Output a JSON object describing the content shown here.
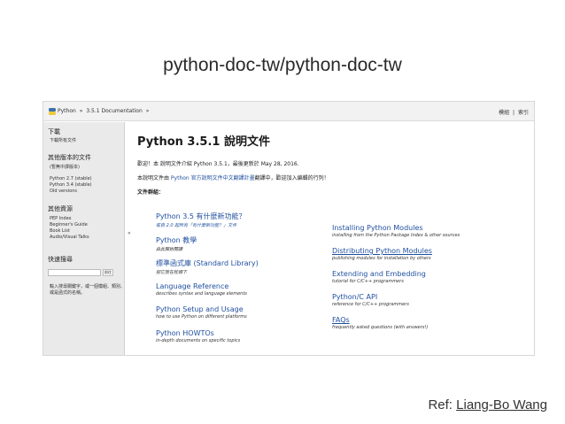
{
  "slide": {
    "title": "python-doc-tw/python-doc-tw",
    "ref_prefix": "Ref: ",
    "ref_author": "Liang-Bo Wang"
  },
  "topbar": {
    "crumbs": [
      "Python",
      "»",
      "3.5.1 Documentation",
      "»"
    ],
    "right": [
      "模組",
      "|",
      "索引"
    ]
  },
  "sidebar": {
    "download_heading": "下載",
    "download_link": "下載所有文件",
    "versions_heading": "其他版本的文件",
    "versions_note": "(暫無中譯版本)",
    "versions": [
      "Python 2.7 (stable)",
      "Python 3.4 (stable)",
      "Old versions"
    ],
    "resources_heading": "其他資源",
    "resources": [
      "PEP Index",
      "Beginner's Guide",
      "Book List",
      "Audio/Visual Talks"
    ],
    "search_heading": "快速搜尋",
    "search_go": "前往",
    "search_hint": [
      "輸入搜尋關鍵字，或一個模組、類別、",
      "或是函式的名稱。"
    ],
    "collapse_glyph": "«"
  },
  "main": {
    "title": "Python 3.5.1 說明文件",
    "welcome": "歡迎！本 說明文件介紹 Python 3.5.1，最後更新於 May 28, 2016.",
    "translation_pre": "本說明文件由 ",
    "translation_link": "Python 官方說明文件中文翻譯計畫",
    "translation_post": "翻譯中，歡迎加入編輯的行列！",
    "sections_label": "文件群組："
  },
  "left_column": [
    {
      "title": "Python 3.5 有什麼新功能？",
      "desc": "或自 2.0 起所有「有什麼新功能？」文件",
      "desc_link": true,
      "underline": false
    },
    {
      "title": "Python 教學",
      "desc": "由此開始閱讀",
      "desc_link": false,
      "underline": false
    },
    {
      "title": "標準函式庫 (Standard Library)",
      "desc": "把它放在枕頭下",
      "desc_link": false,
      "underline": false
    },
    {
      "title": "Language Reference",
      "desc": "describes syntax and language elements",
      "desc_link": false,
      "underline": false
    },
    {
      "title": "Python Setup and Usage",
      "desc": "how to use Python on different platforms",
      "desc_link": false,
      "underline": false
    },
    {
      "title": "Python HOWTOs",
      "desc": "in-depth documents on specific topics",
      "desc_link": false,
      "underline": false
    }
  ],
  "right_column": [
    {
      "title": "Installing Python Modules",
      "desc": "installing from the Python Package Index & other sources",
      "underline": false
    },
    {
      "title": "Distributing Python Modules",
      "desc": "publishing modules for installation by others",
      "underline": true
    },
    {
      "title": "Extending and Embedding",
      "desc": "tutorial for C/C++ programmers",
      "underline": false
    },
    {
      "title": "Python/C API",
      "desc": "reference for C/C++ programmers",
      "underline": false
    },
    {
      "title": "FAQs",
      "desc": "frequently asked questions (with answers!)",
      "underline": true
    }
  ]
}
